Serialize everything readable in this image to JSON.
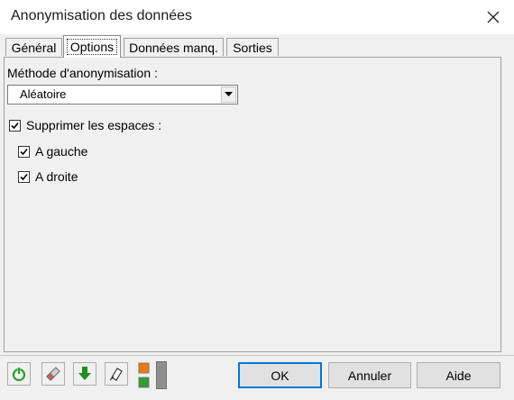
{
  "window": {
    "title": "Anonymisation des données"
  },
  "tabs": [
    {
      "label": "Général"
    },
    {
      "label": "Options"
    },
    {
      "label": "Données manq."
    },
    {
      "label": "Sorties"
    }
  ],
  "options": {
    "method_label": "Méthode d'anonymisation :",
    "method_value": "Aléatoire",
    "remove_spaces": {
      "label": "Supprimer les espaces :",
      "checked": true
    },
    "left": {
      "label": "A gauche",
      "checked": true
    },
    "right": {
      "label": "A droite",
      "checked": true
    }
  },
  "buttons": {
    "ok": "OK",
    "cancel": "Annuler",
    "help": "Aide"
  },
  "icons": [
    "reset-icon",
    "eraser-icon",
    "download-arrow-icon",
    "select-range-icon",
    "color-squares-icon"
  ],
  "colors": {
    "accent": "#0078d7",
    "green": "#2e9e2e",
    "orange": "#f07a00"
  }
}
